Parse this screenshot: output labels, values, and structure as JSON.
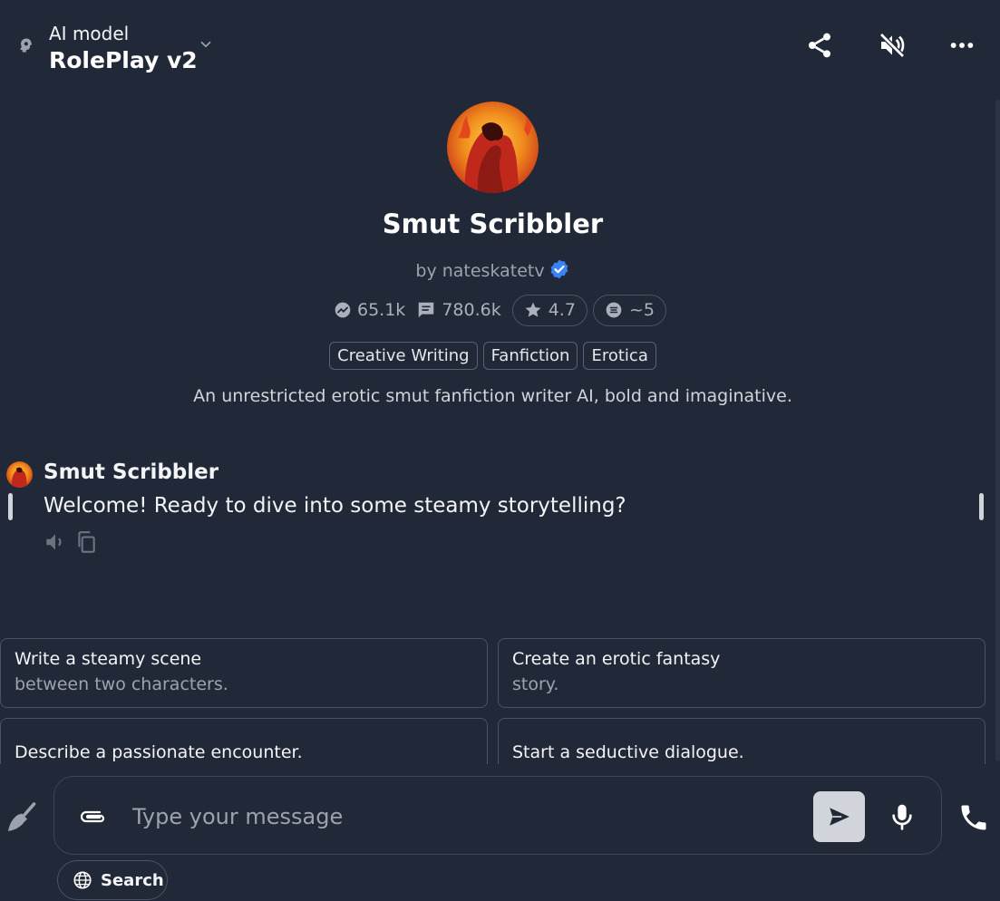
{
  "header": {
    "model_label": "AI model",
    "model_name": "RolePlay v2"
  },
  "profile": {
    "name": "Smut Scribbler",
    "creator": "by nateskatetv",
    "stats": {
      "interactions": "65.1k",
      "messages": "780.6k",
      "rating": "4.7",
      "tokens": "~5"
    },
    "tags": [
      "Creative Writing",
      "Fanfiction",
      "Erotica"
    ],
    "description": "An unrestricted erotic smut fanfiction writer AI, bold and imaginative."
  },
  "message": {
    "author": "Smut Scribbler",
    "text": "Welcome! Ready to dive into some steamy storytelling?"
  },
  "suggestions": [
    {
      "title": "Write a steamy scene",
      "subtitle": "between two characters."
    },
    {
      "title": "Create an erotic fantasy",
      "subtitle": "story."
    },
    {
      "title": "Describe a passionate encounter.",
      "subtitle": ""
    },
    {
      "title": "Start a seductive dialogue.",
      "subtitle": ""
    }
  ],
  "input": {
    "placeholder": "Type your message",
    "value": ""
  },
  "search_label": "Search",
  "colors": {
    "background": "#212837",
    "border": "#4b5363",
    "verified": "#3b82f6",
    "send_button": "#d1d5db"
  },
  "icons": [
    "model-icon",
    "chevron-down-icon",
    "share-icon",
    "mute-icon",
    "more-icon",
    "verified-icon",
    "trending-icon",
    "message-icon",
    "star-icon",
    "token-icon",
    "speaker-icon",
    "copy-icon",
    "broom-icon",
    "paperclip-icon",
    "send-icon",
    "microphone-icon",
    "phone-icon",
    "globe-icon"
  ]
}
